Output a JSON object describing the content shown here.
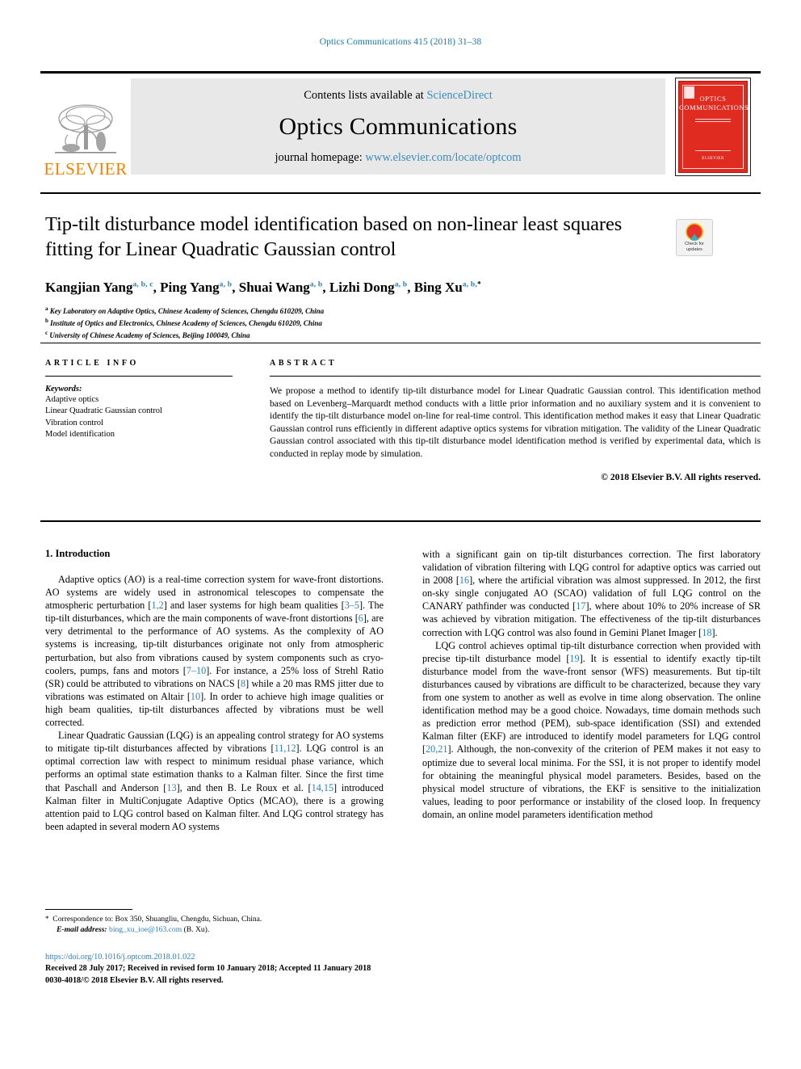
{
  "running_head": "Optics Communications 415 (2018) 31–38",
  "masthead": {
    "contents_prefix": "Contents lists available at ",
    "contents_link": "ScienceDirect",
    "journal_name": "Optics Communications",
    "homepage_prefix": "journal homepage: ",
    "homepage_link": "www.elsevier.com/locate/optcom",
    "publisher_logo_text": "ELSEVIER",
    "cover": {
      "line1": "OPTICS",
      "line2": "COMMUNICATIONS",
      "footer": "ELSEVIER"
    }
  },
  "badge": {
    "line1": "Check for",
    "line2": "updates"
  },
  "article": {
    "title": "Tip-tilt disturbance model identification based on non-linear least squares fitting for Linear Quadratic Gaussian control",
    "authors": [
      {
        "name": "Kangjian Yang",
        "sup": "a, b, c",
        "sep": ", "
      },
      {
        "name": "Ping Yang",
        "sup": "a, b",
        "sep": ", "
      },
      {
        "name": "Shuai Wang",
        "sup": "a, b",
        "sep": ", "
      },
      {
        "name": "Lizhi Dong",
        "sup": "a, b",
        "sep": ", "
      },
      {
        "name": "Bing Xu",
        "sup": "a, b,",
        "sup_star": "*",
        "sep": ""
      }
    ],
    "affiliations": [
      {
        "mark": "a",
        "text": "Key Laboratory on Adaptive Optics, Chinese Academy of Sciences, Chengdu 610209, China"
      },
      {
        "mark": "b",
        "text": "Institute of Optics and Electronics, Chinese Academy of Sciences, Chengdu 610209, China"
      },
      {
        "mark": "c",
        "text": "University of Chinese Academy of Sciences, Beijing 100049, China"
      }
    ]
  },
  "info": {
    "heading": "ARTICLE INFO",
    "keywords_label": "Keywords:",
    "keywords": [
      "Adaptive optics",
      "Linear Quadratic Gaussian control",
      "Vibration control",
      "Model identification"
    ]
  },
  "abstract": {
    "heading": "ABSTRACT",
    "text": "We propose a method to identify tip-tilt disturbance model for Linear Quadratic Gaussian control. This identification method based on Levenberg–Marquardt method conducts with a little prior information and no auxiliary system and it is convenient to identify the tip-tilt disturbance model on-line for real-time control. This identification method makes it easy that Linear Quadratic Gaussian control runs efficiently in different adaptive optics systems for vibration mitigation. The validity of the Linear Quadratic Gaussian control associated with this tip-tilt disturbance model identification method is verified by experimental data, which is conducted in replay mode by simulation.",
    "copyright": "© 2018 Elsevier B.V. All rights reserved."
  },
  "body": {
    "section_title": "1. Introduction",
    "left_paragraphs": [
      "Adaptive optics (AO) is a real-time correction system for wave-front distortions. AO systems are widely used in astronomical telescopes to compensate the atmospheric perturbation [1,2] and laser systems for high beam qualities [3–5]. The tip-tilt disturbances, which are the main components of wave-front distortions [6], are very detrimental to the performance of AO systems. As the complexity of AO systems is increasing, tip-tilt disturbances originate not only from atmospheric perturbation, but also from vibrations caused by system components such as cryo-coolers, pumps, fans and motors [7–10]. For instance, a 25% loss of Strehl Ratio (SR) could be attributed to vibrations on NACS [8] while a 20 mas RMS jitter due to vibrations was estimated on Altair [10]. In order to achieve high image qualities or high beam qualities, tip-tilt disturbances affected by vibrations must be well corrected.",
      "Linear Quadratic Gaussian (LQG) is an appealing control strategy for AO systems to mitigate tip-tilt disturbances affected by vibrations [11,12]. LQG control is an optimal correction law with respect to minimum residual phase variance, which performs an optimal state estimation thanks to a Kalman filter. Since the first time that Paschall and Anderson [13], and then B. Le Roux et al. [14,15] introduced Kalman filter in MultiConjugate Adaptive Optics (MCAO), there is a growing attention paid to LQG control based on Kalman filter. And LQG control strategy has been adapted in several modern AO systems"
    ],
    "right_paragraphs": [
      "with a significant gain on tip-tilt disturbances correction. The first laboratory validation of vibration filtering with LQG control for adaptive optics was carried out in 2008 [16], where the artificial vibration was almost suppressed. In 2012, the first on-sky single conjugated AO (SCAO) validation of full LQG control on the CANARY pathfinder was conducted [17], where about 10% to 20% increase of SR was achieved by vibration mitigation. The effectiveness of the tip-tilt disturbances correction with LQG control was also found in Gemini Planet Imager [18].",
      "LQG control achieves optimal tip-tilt disturbance correction when provided with precise tip-tilt disturbance model [19]. It is essential to identify exactly tip-tilt disturbance model from the wave-front sensor (WFS) measurements. But tip-tilt disturbances caused by vibrations are difficult to be characterized, because they vary from one system to another as well as evolve in time along observation. The online identification method may be a good choice. Nowadays, time domain methods such as prediction error method (PEM), sub-space identification (SSI) and extended Kalman filter (EKF) are introduced to identify model parameters for LQG control [20,21]. Although, the non-convexity of the criterion of PEM makes it not easy to optimize due to several local minima. For the SSI, it is not proper to identify model for obtaining the meaningful physical model parameters. Besides, based on the physical model structure of vibrations, the EKF is sensitive to the initialization values, leading to poor performance or instability of the closed loop. In frequency domain, an online model parameters identification method"
    ]
  },
  "footnote": {
    "star": "*",
    "correspondence": "Correspondence to: Box 350, Shuangliu, Chengdu, Sichuan, China.",
    "email_label": "E-mail address:",
    "email": "bing_xu_ioe@163.com",
    "email_suffix": "(B. Xu)."
  },
  "footer": {
    "doi": "https://doi.org/10.1016/j.optcom.2018.01.022",
    "history": "Received 28 July 2017; Received in revised form 10 January 2018; Accepted 11 January 2018",
    "issn": "0030-4018/© 2018 Elsevier B.V. All rights reserved."
  },
  "colors": {
    "link": "#2c7fb8",
    "running_head": "#1a7aa8",
    "elsevier_orange": "#ef8200",
    "cover_red": "#e02b20"
  }
}
